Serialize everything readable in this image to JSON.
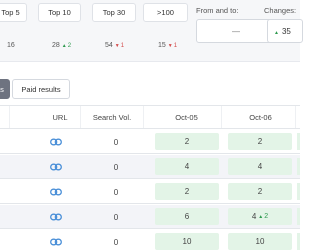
{
  "rank_buckets": [
    {
      "label": "Top 5",
      "count": "16",
      "change": "",
      "direction": ""
    },
    {
      "label": "Top 10",
      "count": "28",
      "change": "2",
      "direction": "up"
    },
    {
      "label": "Top 30",
      "count": "54",
      "change": "1",
      "direction": "down"
    },
    {
      "label": ">100",
      "count": "15",
      "change": "1",
      "direction": "down"
    }
  ],
  "date_range": {
    "label": "From and to:",
    "value": "—"
  },
  "changes": {
    "label": "Changes:",
    "value": "35",
    "direction": "up"
  },
  "filters": {
    "active_fragment": "s",
    "paid_results": "Paid results"
  },
  "table": {
    "headers": {
      "url": "URL",
      "search_vol": "Search Vol.",
      "date1": "Oct-05",
      "date2": "Oct-06"
    },
    "rows": [
      {
        "search_vol": "0",
        "date1": "2",
        "date2": "2",
        "date2_change": ""
      },
      {
        "search_vol": "0",
        "date1": "4",
        "date2": "4",
        "date2_change": ""
      },
      {
        "search_vol": "0",
        "date1": "2",
        "date2": "2",
        "date2_change": ""
      },
      {
        "search_vol": "0",
        "date1": "6",
        "date2": "4",
        "date2_change": "2"
      },
      {
        "search_vol": "0",
        "date1": "10",
        "date2": "10",
        "date2_change": ""
      }
    ]
  },
  "colors": {
    "link_blue": "#4a8fd8",
    "positive_green": "#2e9a4f",
    "negative_red": "#d34b4b",
    "cell_green_bg": "#e3f4e7"
  }
}
